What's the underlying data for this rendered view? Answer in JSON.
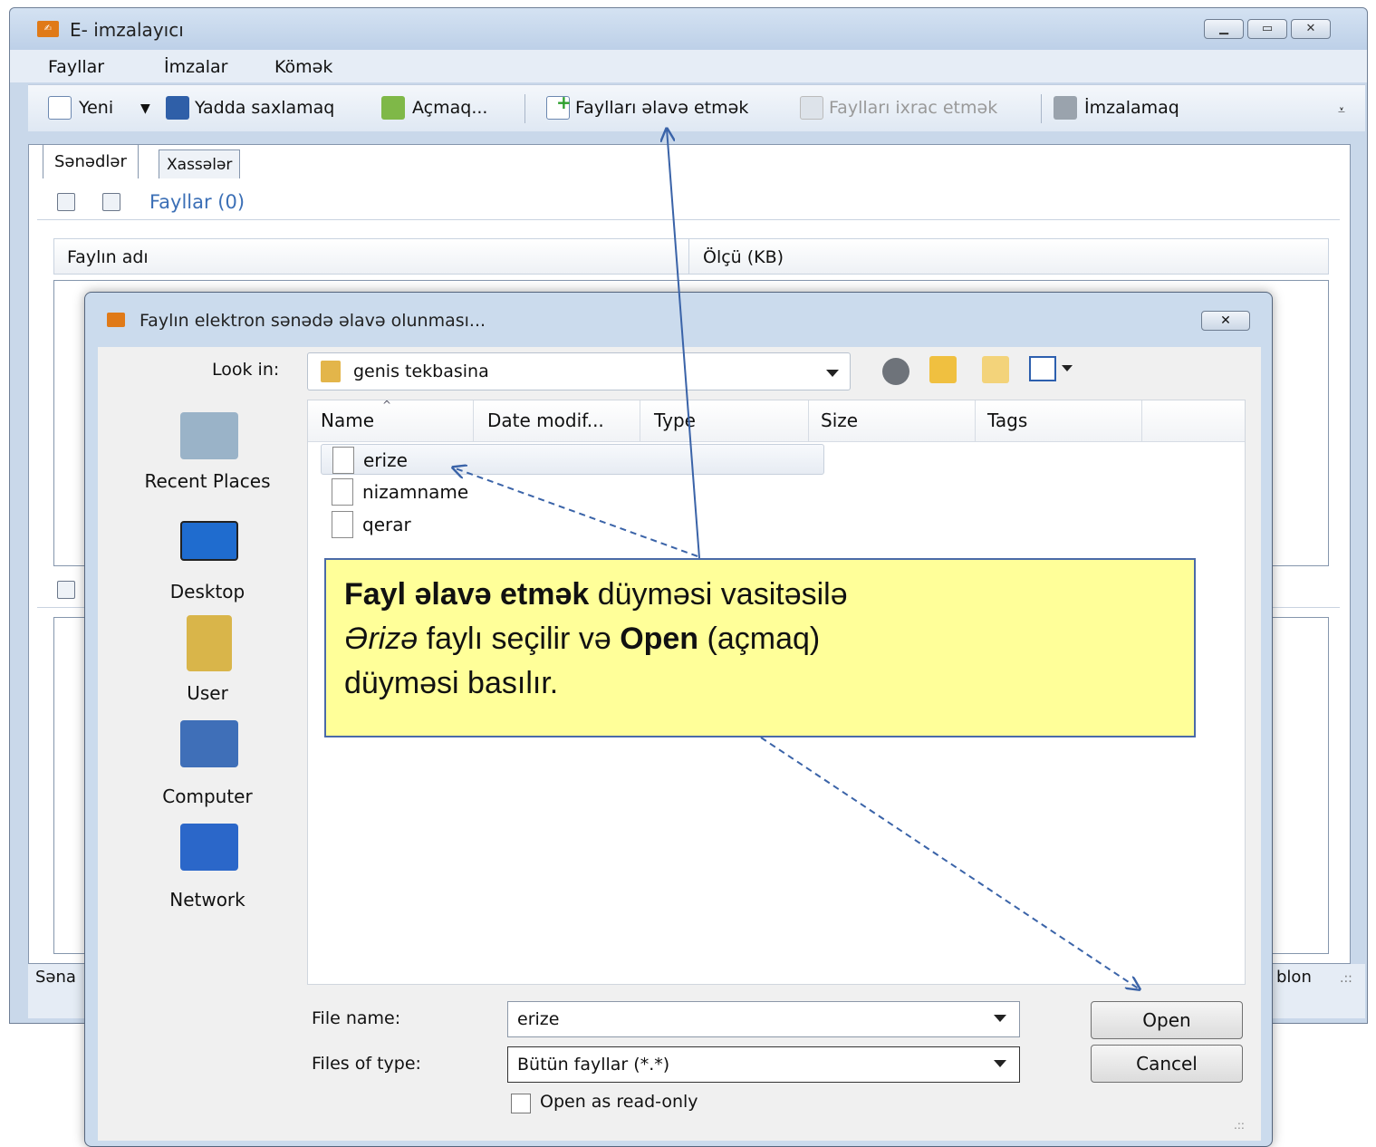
{
  "main_window": {
    "title": "E- imzalayıcı",
    "app_icon": "signature-app-icon",
    "window_buttons": [
      "minimize",
      "maximize",
      "close"
    ]
  },
  "menu": [
    "Fayllar",
    "İmzalar",
    "Kömək"
  ],
  "toolbar": {
    "new": "Yeni",
    "save": "Yadda saxlamaq",
    "open": "Açmaq...",
    "add_files": "Faylları əlavə etmək",
    "export_files": "Faylları ixrac etmək",
    "sign": "İmzalamaq"
  },
  "tabs": [
    "Sənədlər",
    "Xassələr"
  ],
  "files_panel": {
    "title": "Fayllar (0)",
    "columns": [
      "Faylın adı",
      "Ölçü (KB)"
    ]
  },
  "statusbar": {
    "left": "Səna",
    "right": "blon"
  },
  "dialog": {
    "title": "Faylın elektron sənədə əlavə olunması...",
    "look_in_label": "Look in:",
    "look_in_value": "genis tekbasina",
    "places": [
      "Recent Places",
      "Desktop",
      "User",
      "Computer",
      "Network"
    ],
    "columns": [
      "Name",
      "Date modif...",
      "Type",
      "Size",
      "Tags"
    ],
    "files": [
      "erize",
      "nizamname",
      "qerar"
    ],
    "file_name_label": "File name:",
    "file_name_value": "erize",
    "files_of_type_label": "Files of type:",
    "files_of_type_value": "Bütün fayllar (*.*)",
    "read_only_label": "Open as read-only",
    "open_button": "Open",
    "cancel_button": "Cancel"
  },
  "callout": {
    "bold1": "Fayl əlavə etmək",
    "text1": " düyməsi vasitəsilə",
    "italic": "Ərizə",
    "text2": " faylı seçilir və ",
    "bold2": "Open",
    "text3": " (açmaq)",
    "text4": "düyməsi basılır."
  },
  "colors": {
    "callout_bg": "#ffff99",
    "callout_border": "#4a6aa8",
    "arrow": "#3a63a8"
  }
}
